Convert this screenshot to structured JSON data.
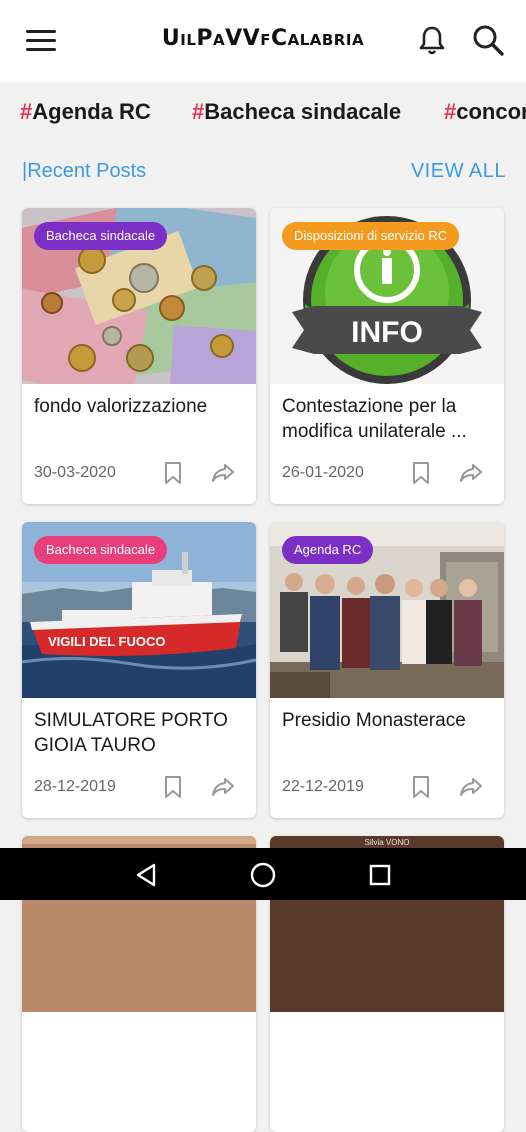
{
  "app": {
    "title": "UilPaVVfCalabria"
  },
  "icons": {
    "menu": "menu-icon",
    "notifications": "bell-icon",
    "search": "search-icon",
    "bookmark": "bookmark-icon",
    "share": "share-icon"
  },
  "tags": [
    {
      "hash": "#",
      "label": "Agenda RC"
    },
    {
      "hash": "#",
      "label": "Bacheca sindacale"
    },
    {
      "hash": "#",
      "label": "concor"
    }
  ],
  "section": {
    "title": "|Recent Posts",
    "view_all": "VIEW ALL"
  },
  "colors": {
    "accent_blue": "#3a9be0",
    "hash_red": "#e8334f",
    "badge_purple": "#7b2fc4",
    "badge_pink": "#e83e7a",
    "badge_orange": "#f39a1f"
  },
  "posts": [
    {
      "category": "Bacheca sindacale",
      "badge_color": "#7b2fc4",
      "title": "fondo valorizzazione",
      "date": "30-03-2020"
    },
    {
      "category": "Disposizioni di servizio RC",
      "badge_color": "#f39a1f",
      "title": "Contestazione per la modifica unilaterale ...",
      "date": "26-01-2020",
      "image_text": "INFO"
    },
    {
      "category": "Bacheca sindacale",
      "badge_color": "#e83e7a",
      "title": "SIMULATORE PORTO GIOIA TAURO",
      "date": "28-12-2019",
      "image_text": "VIGILI DEL FUOCO"
    },
    {
      "category": "Agenda RC",
      "badge_color": "#7b2fc4",
      "title": "Presidio Monasterace",
      "date": "22-12-2019"
    }
  ],
  "partial_cards": [
    {
      "image_text": "Silvia VONO"
    }
  ],
  "system_nav": {
    "back": "back-icon",
    "home": "home-icon",
    "recents": "recents-icon"
  }
}
